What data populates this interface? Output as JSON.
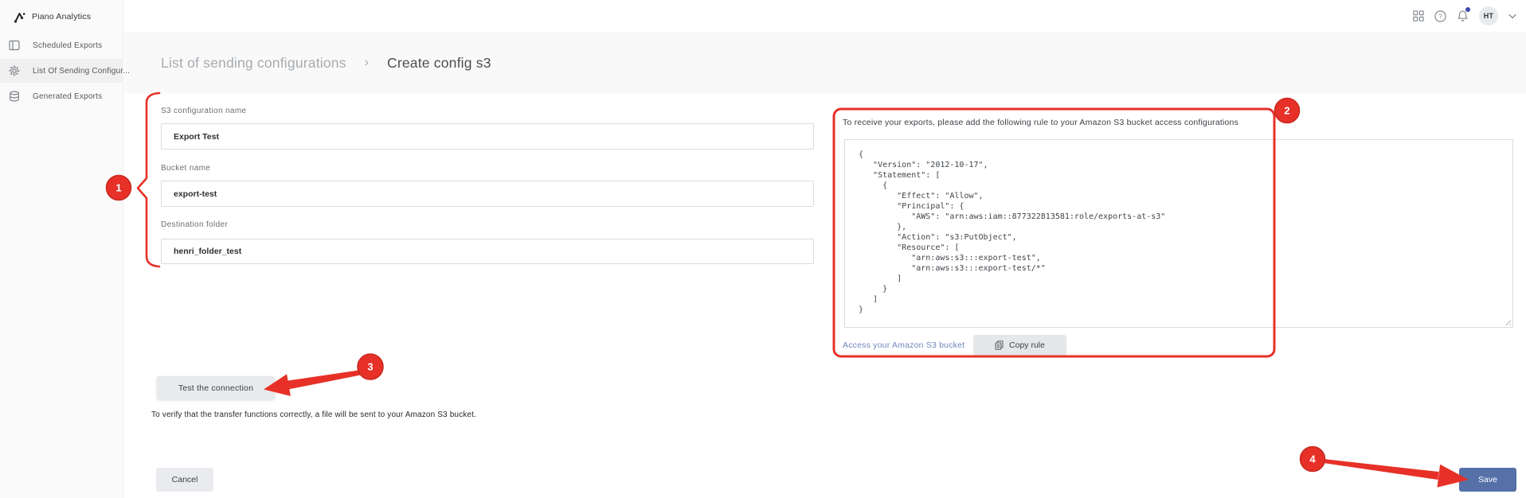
{
  "brand": {
    "name": "Piano Analytics"
  },
  "sidebar": {
    "items": [
      {
        "label": "Scheduled Exports"
      },
      {
        "label": "List Of Sending Configur..."
      },
      {
        "label": "Generated Exports"
      }
    ]
  },
  "topbar": {
    "avatar_initials": "HT",
    "help_glyph": "?"
  },
  "breadcrumb": {
    "parent": "List of sending configurations",
    "separator": "›",
    "current": "Create config s3"
  },
  "form": {
    "fields": [
      {
        "label": "S3 configuration name",
        "value": "Export Test"
      },
      {
        "label": "Bucket name",
        "value": "export-test"
      },
      {
        "label": "Destination folder",
        "value": "henri_folder_test"
      }
    ],
    "test_button_label": "Test the connection",
    "note": "To verify that the transfer functions correctly, a file will be sent to your Amazon S3 bucket.",
    "cancel_label": "Cancel",
    "save_label": "Save"
  },
  "rule_panel": {
    "instruction": "To receive your exports, please add the following rule to your Amazon S3 bucket access configurations",
    "code": "{\n   \"Version\": \"2012-10-17\",\n   \"Statement\": [\n     {\n        \"Effect\": \"Allow\",\n        \"Principal\": {\n           \"AWS\": \"arn:aws:iam::877322813581:role/exports-at-s3\"\n        },\n        \"Action\": \"s3:PutObject\",\n        \"Resource\": [\n           \"arn:aws:s3:::export-test\",\n           \"arn:aws:s3:::export-test/*\"\n        ]\n     }\n   ]\n}",
    "link_label": "Access your Amazon S3 bucket",
    "copy_button_label": "Copy rule"
  },
  "annotations": {
    "badge1": "1",
    "badge2": "2",
    "badge3": "3",
    "badge4": "4",
    "color": "#e73128"
  },
  "colors": {
    "accent_red": "#e73128",
    "save_blue": "#5571a8",
    "link_blue": "#6e87bb"
  }
}
